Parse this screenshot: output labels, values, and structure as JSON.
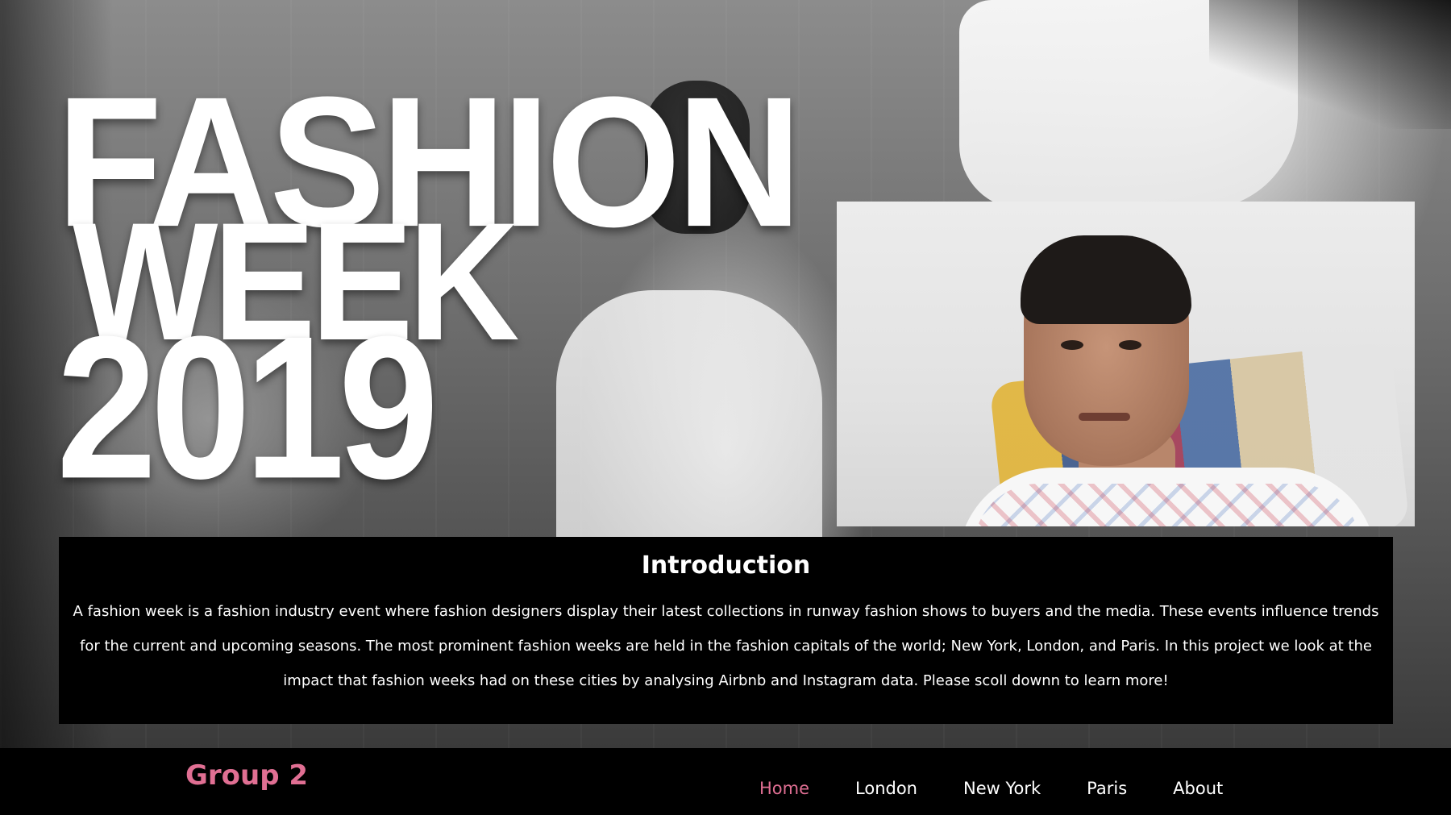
{
  "hero": {
    "headline_line1": "FASHION",
    "headline_line2": "WEEK",
    "headline_line3": "2019"
  },
  "intro": {
    "title": "Introduction",
    "body": "A fashion week is a fashion industry event where fashion designers display their latest collections in runway fashion shows to buyers and the media. These events influence trends for the current and upcoming seasons. The most prominent fashion weeks are held in the fashion capitals of the world; New York, London, and Paris. In this project we look at the impact that fashion weeks had on these cities by analysing Airbnb and Instagram data. Please scoll downn to learn more!"
  },
  "navbar": {
    "brand": "Group 2",
    "items": [
      {
        "label": "Home",
        "active": true
      },
      {
        "label": "London",
        "active": false
      },
      {
        "label": "New York",
        "active": false
      },
      {
        "label": "Paris",
        "active": false
      },
      {
        "label": "About",
        "active": false
      }
    ]
  },
  "colors": {
    "accent": "#e06f93",
    "bar": "#000000",
    "text": "#ffffff"
  }
}
